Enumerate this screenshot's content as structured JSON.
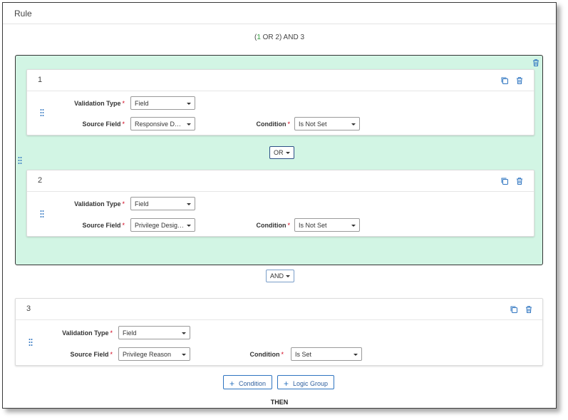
{
  "header": {
    "title": "Rule"
  },
  "expression": {
    "open": "(",
    "first": "1",
    "rest": " OR 2) AND 3"
  },
  "group": {
    "cards": [
      {
        "number": "1",
        "validation_type": {
          "label": "Validation Type",
          "value": "Field"
        },
        "source_field": {
          "label": "Source Field",
          "value": "Responsive Desi..."
        },
        "condition": {
          "label": "Condition",
          "value": "Is Not Set"
        }
      },
      {
        "number": "2",
        "validation_type": {
          "label": "Validation Type",
          "value": "Field"
        },
        "source_field": {
          "label": "Source Field",
          "value": "Privilege Designa..."
        },
        "condition": {
          "label": "Condition",
          "value": "Is Not Set"
        }
      }
    ],
    "inner_operator": "OR"
  },
  "outer_operator": "AND",
  "card3": {
    "number": "3",
    "validation_type": {
      "label": "Validation Type",
      "value": "Field"
    },
    "source_field": {
      "label": "Source Field",
      "value": "Privilege Reason"
    },
    "condition": {
      "label": "Condition",
      "value": "Is Set"
    }
  },
  "required_marker": "*",
  "actions": {
    "add_condition": "Condition",
    "add_logic_group": "Logic Group",
    "plus": "+"
  },
  "then_label": "THEN",
  "colors": {
    "group_bg": "#d2f5e4",
    "accent": "#2e74c0",
    "required": "#d0021b"
  },
  "icons": [
    "copy-icon",
    "trash-icon",
    "drag-handle-icon",
    "plus-icon",
    "caret-down-icon"
  ]
}
